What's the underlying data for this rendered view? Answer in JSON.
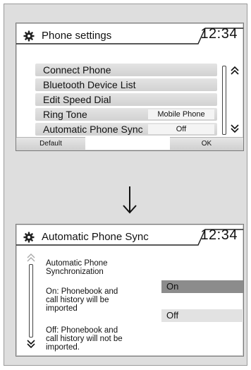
{
  "top_screen": {
    "title": "Phone settings",
    "clock": "12:34",
    "items": [
      {
        "label": "Connect Phone",
        "value": ""
      },
      {
        "label": "Bluetooth Device List",
        "value": ""
      },
      {
        "label": "Edit Speed Dial",
        "value": ""
      },
      {
        "label": "Ring Tone",
        "value": "Mobile Phone"
      },
      {
        "label": "Automatic Phone Sync",
        "value": "Off"
      }
    ],
    "softkeys": {
      "left": "Default",
      "right": "OK"
    },
    "icons": {
      "title": "gear-icon",
      "up": "double-chevron-up-icon",
      "down": "double-chevron-down-icon"
    }
  },
  "transition": {
    "icon": "arrow-down-icon"
  },
  "bottom_screen": {
    "title": "Automatic Phone Sync",
    "clock": "12:34",
    "heading_line1": "Automatic Phone",
    "heading_line2": "Synchronization",
    "on_desc_line1": "On: Phonebook and",
    "on_desc_line2": "call history will be",
    "on_desc_line3": "imported",
    "off_desc_line1": "Off: Phonebook and",
    "off_desc_line2": "call history will not be",
    "off_desc_line3": "imported.",
    "options": [
      "On",
      "Off"
    ],
    "selected": "On"
  },
  "colors": {
    "frame_bg": "#dedede",
    "row_bg": "#d8d8d8",
    "selected_option": "#8c8c8c"
  }
}
